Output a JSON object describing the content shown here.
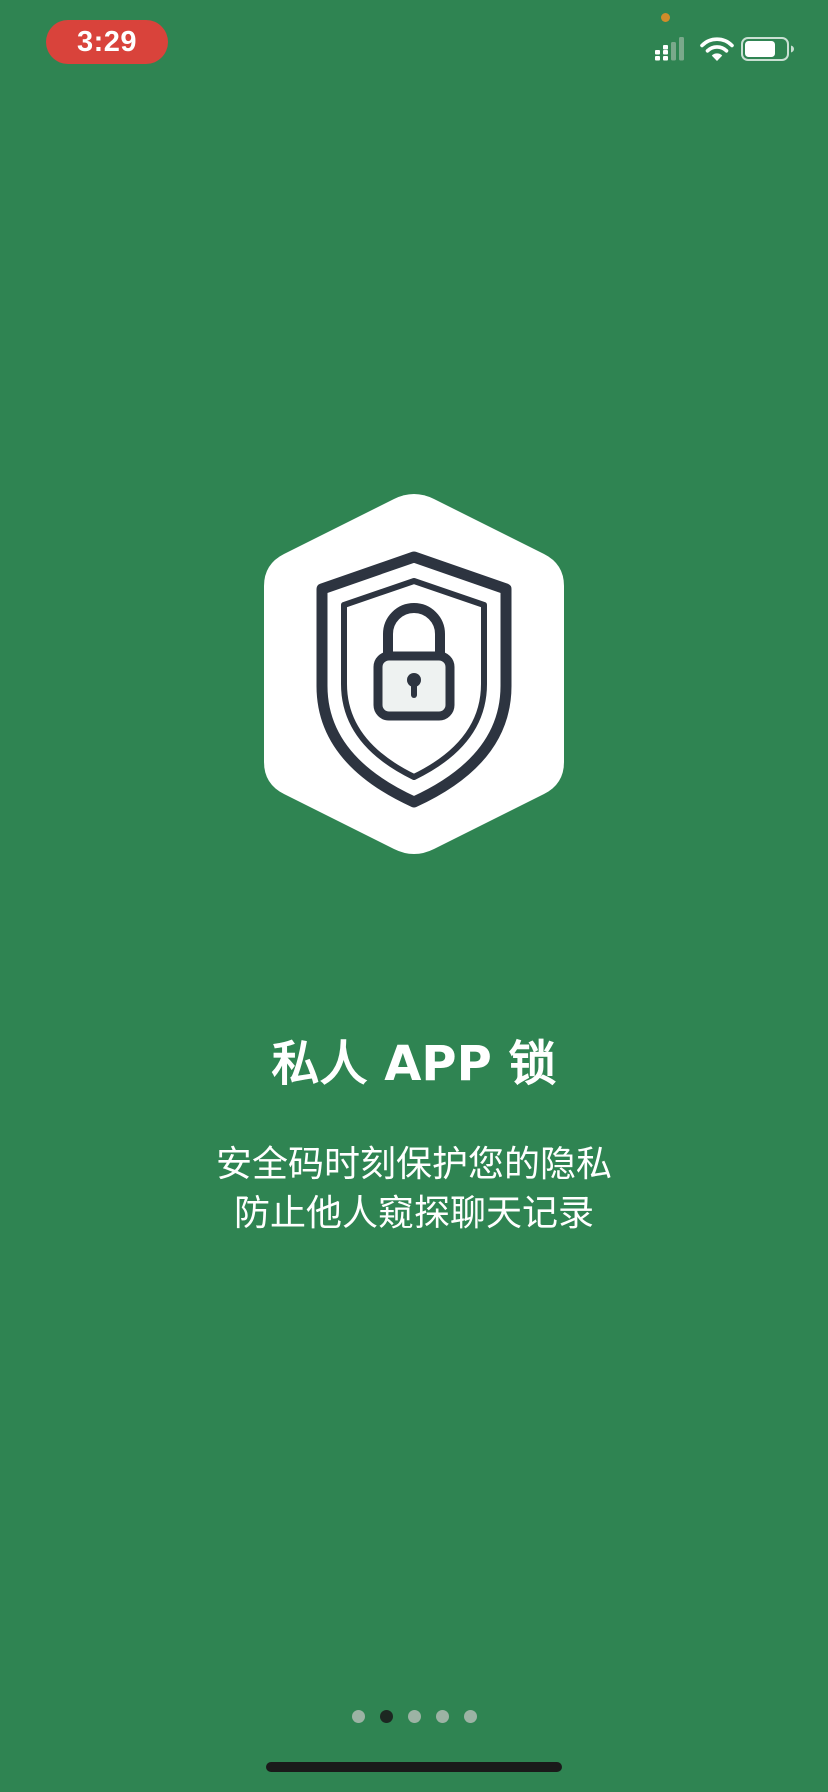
{
  "status_bar": {
    "time": "3:29",
    "signal_icon": "cellular-signal-icon",
    "wifi_icon": "wifi-icon",
    "battery_icon": "battery-icon",
    "battery_level": 0.75
  },
  "colors": {
    "background": "#2f8452",
    "time_pill": "#d9433b",
    "logo_stroke": "#2d3440",
    "pager_active": "#1c2721",
    "pager_inactive": "#9cb3a4"
  },
  "onboarding": {
    "logo_icon": "shield-lock-icon",
    "title": "私人 APP 锁",
    "subtitle_lines": [
      "安全码时刻保护您的隐私",
      "防止他人窥探聊天记录"
    ]
  },
  "pager": {
    "total_pages": 5,
    "active_page": 2
  }
}
